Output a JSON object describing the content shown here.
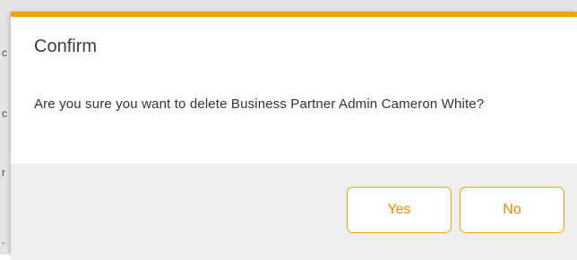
{
  "dialog": {
    "title": "Confirm",
    "message": "Are you sure you want to delete Business Partner Admin Cameron White?",
    "buttons": {
      "yes_label": "Yes",
      "no_label": "No"
    }
  },
  "colors": {
    "accent": "#f5a300",
    "button_text": "#e58e00",
    "footer_bg": "#edeef0",
    "overlay_bg": "#e4e4e4"
  }
}
